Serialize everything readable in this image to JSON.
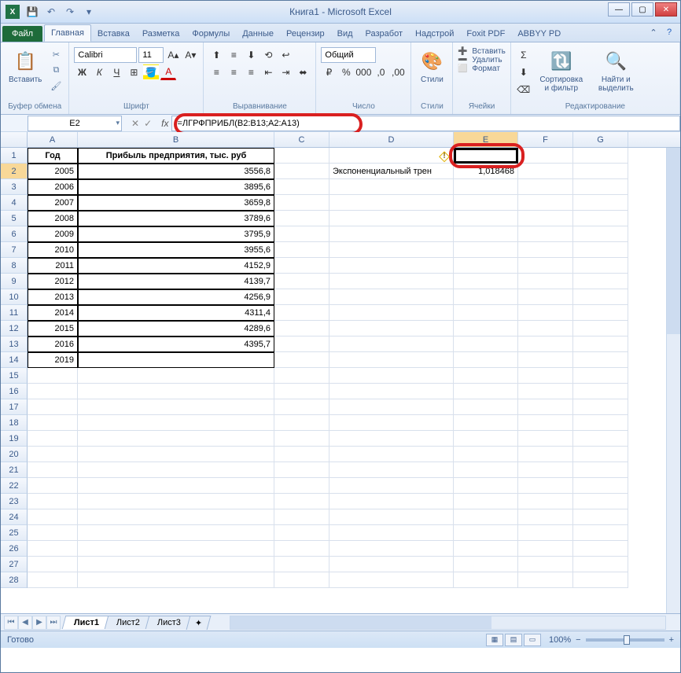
{
  "window": {
    "title": "Книга1 - Microsoft Excel"
  },
  "qat": {
    "save": "💾",
    "undo": "↶",
    "redo": "↷"
  },
  "tabs": {
    "file": "Файл",
    "items": [
      "Главная",
      "Вставка",
      "Разметка",
      "Формулы",
      "Данные",
      "Рецензир",
      "Вид",
      "Разработ",
      "Надстрой",
      "Foxit PDF",
      "ABBYY PD"
    ],
    "active": 0
  },
  "ribbon": {
    "clipboard": {
      "label": "Буфер обмена",
      "paste": "Вставить",
      "cut": "✂",
      "copy": "⧉",
      "brush": "🖌"
    },
    "font": {
      "label": "Шрифт",
      "name": "Calibri",
      "size": "11"
    },
    "align": {
      "label": "Выравнивание"
    },
    "number": {
      "label": "Число",
      "format": "Общий"
    },
    "styles": {
      "label": "Стили",
      "btn": "Стили"
    },
    "cells": {
      "label": "Ячейки",
      "insert": "Вставить",
      "delete": "Удалить",
      "format": "Формат"
    },
    "editing": {
      "label": "Редактирование",
      "sort": "Сортировка и фильтр",
      "find": "Найти и выделить"
    }
  },
  "namebox": "E2",
  "formula": "=ЛГРФПРИБЛ(B2:B13;A2:A13)",
  "columns": [
    "A",
    "B",
    "C",
    "D",
    "E",
    "F",
    "G"
  ],
  "headers": {
    "A": "Год",
    "B": "Прибыль предприятия, тыс. руб"
  },
  "dataA": [
    "2005",
    "2006",
    "2007",
    "2008",
    "2009",
    "2010",
    "2011",
    "2012",
    "2013",
    "2014",
    "2015",
    "2016",
    "2019"
  ],
  "dataB": [
    "3556,8",
    "3895,6",
    "3659,8",
    "3789,6",
    "3795,9",
    "3955,6",
    "4152,9",
    "4139,7",
    "4256,9",
    "4311,4",
    "4289,6",
    "4395,7",
    ""
  ],
  "d2_label": "Экспоненциальный трен",
  "e2_value": "1,018468",
  "sheets": {
    "items": [
      "Лист1",
      "Лист2",
      "Лист3"
    ],
    "active": 0
  },
  "status": {
    "ready": "Готово",
    "zoom": "100%"
  }
}
